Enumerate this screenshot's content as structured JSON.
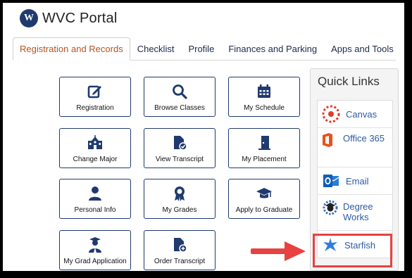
{
  "app": {
    "title": "WVC Portal",
    "logo_text": "W"
  },
  "tabs": [
    {
      "label": "Registration and Records"
    },
    {
      "label": "Checklist"
    },
    {
      "label": "Profile"
    },
    {
      "label": "Finances and Parking"
    },
    {
      "label": "Apps and Tools"
    }
  ],
  "tiles": [
    {
      "label": "Registration",
      "icon": "edit-icon"
    },
    {
      "label": "Browse Classes",
      "icon": "search-icon"
    },
    {
      "label": "My Schedule",
      "icon": "calendar-icon"
    },
    {
      "label": "Change Major",
      "icon": "school-building-icon"
    },
    {
      "label": "View Transcript",
      "icon": "document-check-icon"
    },
    {
      "label": "My Placement",
      "icon": "door-icon"
    },
    {
      "label": "Personal Info",
      "icon": "user-icon"
    },
    {
      "label": "My Grades",
      "icon": "award-icon"
    },
    {
      "label": "Apply to Graduate",
      "icon": "graduation-cap-icon"
    },
    {
      "label": "My Grad Application",
      "icon": "graduate-user-icon"
    },
    {
      "label": "Order Transcript",
      "icon": "document-plus-icon"
    }
  ],
  "quick_links": {
    "title": "Quick Links",
    "items": [
      {
        "label": "Canvas",
        "icon": "canvas-icon"
      },
      {
        "label": "Office 365",
        "icon": "office-icon"
      },
      {
        "label": "Email",
        "icon": "outlook-icon"
      },
      {
        "label": "Degree Works",
        "icon": "degreeworks-icon"
      },
      {
        "label": "Starfish",
        "icon": "starfish-icon"
      }
    ]
  },
  "colors": {
    "navy": "#1f3a6e",
    "active_tab": "#b5531f",
    "link": "#2d5aa5",
    "highlight": "#e84141"
  }
}
